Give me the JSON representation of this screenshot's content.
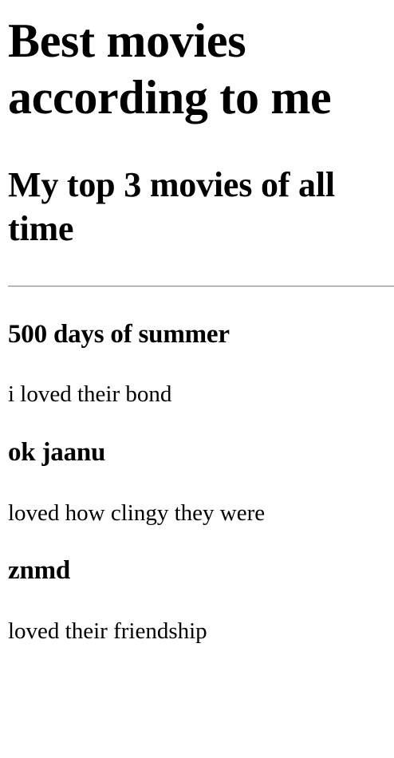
{
  "page": {
    "title": "Best movies according to me",
    "subtitle": "My top 3 movies of all time"
  },
  "movies": [
    {
      "title": "500 days of summer",
      "note": "i loved their bond"
    },
    {
      "title": "ok jaanu",
      "note": "loved how clingy they were"
    },
    {
      "title": "znmd",
      "note": "loved their friendship"
    }
  ]
}
